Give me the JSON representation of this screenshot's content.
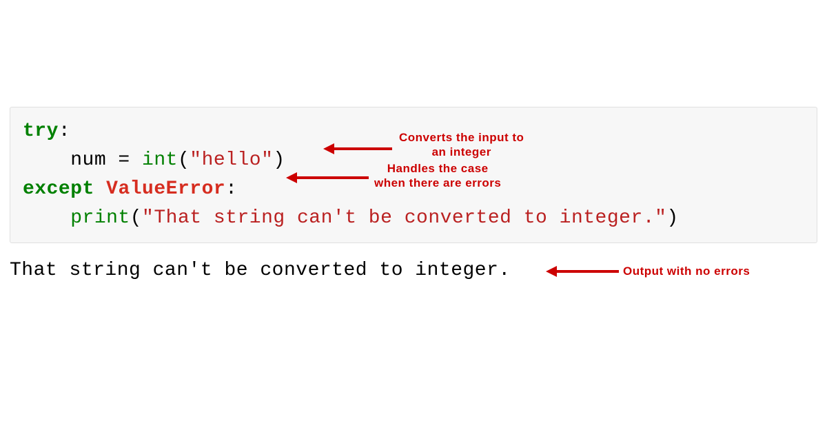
{
  "code": {
    "lines": [
      {
        "segments": [
          {
            "text": "try",
            "class": "kw-green"
          },
          {
            "text": ":",
            "class": "txt-black"
          }
        ]
      },
      {
        "segments": [
          {
            "text": "    num ",
            "class": "txt-black"
          },
          {
            "text": "=",
            "class": "txt-black"
          },
          {
            "text": " ",
            "class": "txt-black"
          },
          {
            "text": "int",
            "class": "fn-green"
          },
          {
            "text": "(",
            "class": "paren"
          },
          {
            "text": "\"hello\"",
            "class": "str-red"
          },
          {
            "text": ")",
            "class": "paren"
          }
        ]
      },
      {
        "segments": [
          {
            "text": "except",
            "class": "kw-green"
          },
          {
            "text": " ",
            "class": "txt-black"
          },
          {
            "text": "ValueError",
            "class": "err-red"
          },
          {
            "text": ":",
            "class": "txt-black"
          }
        ]
      },
      {
        "segments": [
          {
            "text": "    ",
            "class": "txt-black"
          },
          {
            "text": "print",
            "class": "fn-green"
          },
          {
            "text": "(",
            "class": "paren"
          },
          {
            "text": "\"That string can't be converted to integer.\"",
            "class": "str-red"
          },
          {
            "text": ")",
            "class": "paren"
          }
        ]
      }
    ]
  },
  "output": "That string can't be converted to integer.",
  "annotations": {
    "convert": "Converts the input to\nan integer",
    "handles": "Handles the case\nwhen there are errors",
    "outputnote": "Output with no errors"
  }
}
